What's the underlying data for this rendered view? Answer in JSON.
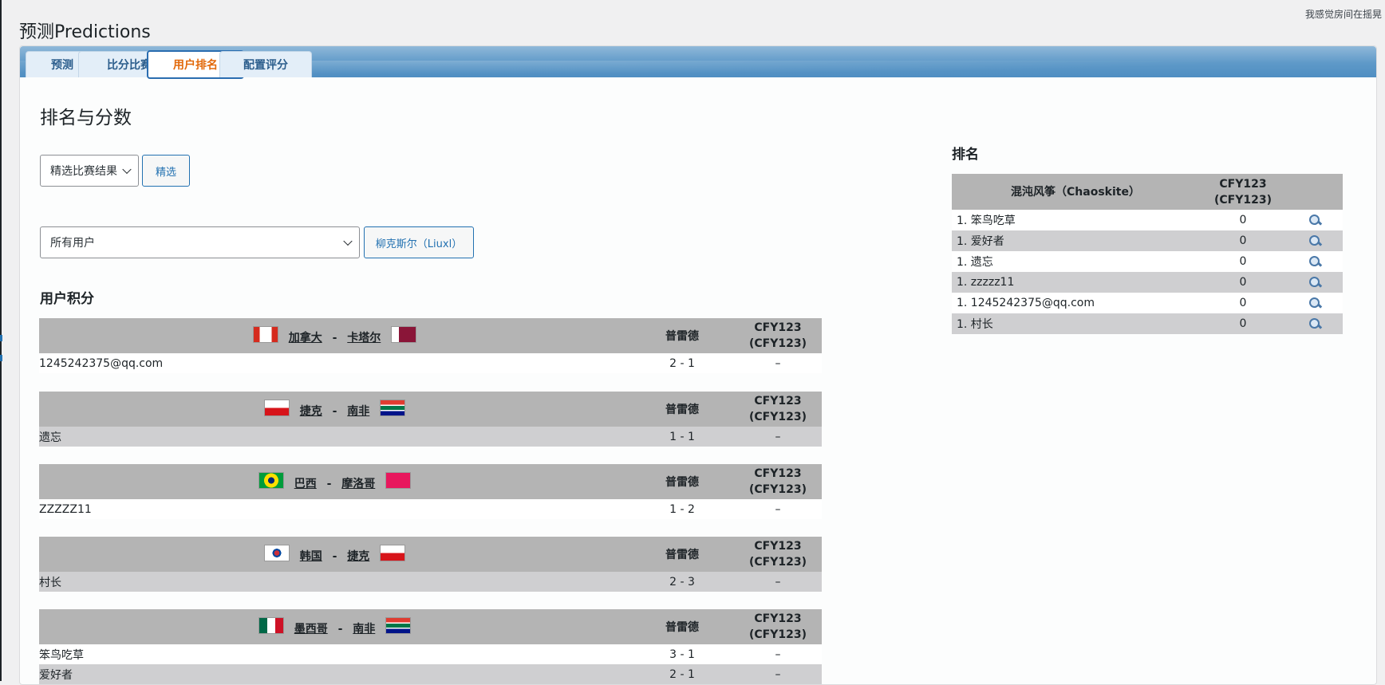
{
  "top_right_note": "我感觉房间在摇晃",
  "app_title": "预测Predictions",
  "tabs": [
    {
      "label": "预测"
    },
    {
      "label": "比分比赛"
    },
    {
      "label": "用户排名"
    },
    {
      "label": "配置评分"
    }
  ],
  "main": {
    "section_title": "排名与分数",
    "match_filter_select": "精选比赛结果",
    "filter_button": "精选",
    "user_select": "所有用户",
    "user_button": "柳克斯尔（Liuxl）",
    "user_scores_heading": "用户积分"
  },
  "score_tables": [
    {
      "home": "加拿大",
      "away": "卡塔尔",
      "dash": "-",
      "home_flag": "ca-flag",
      "away_flag": "qa-flag",
      "col_score": "普雷德",
      "col_cfy": "CFY123",
      "col_cfy2": "(CFY123)",
      "rows": [
        {
          "name": "1245242375@qq.com",
          "score": "2 - 1",
          "cfy": "–"
        }
      ]
    },
    {
      "home": "捷克",
      "away": "南非",
      "dash": "-",
      "home_flag": "cz-flag",
      "away_flag": "za-flag",
      "col_score": "普雷德",
      "col_cfy": "CFY123",
      "col_cfy2": "(CFY123)",
      "rows": [
        {
          "name": "遗忘",
          "score": "1 - 1",
          "cfy": "–"
        }
      ]
    },
    {
      "home": "巴西",
      "away": "摩洛哥",
      "dash": "-",
      "home_flag": "br-flag",
      "away_flag": "ma-flag",
      "col_score": "普雷德",
      "col_cfy": "CFY123",
      "col_cfy2": "(CFY123)",
      "rows": [
        {
          "name": "ZZZZZ11",
          "score": "1 - 2",
          "cfy": "–"
        }
      ]
    },
    {
      "home": "韩国",
      "away": "捷克",
      "dash": "-",
      "home_flag": "kr-flag",
      "away_flag": "cz-flag",
      "col_score": "普雷德",
      "col_cfy": "CFY123",
      "col_cfy2": "(CFY123)",
      "rows": [
        {
          "name": "村长",
          "score": "2 - 3",
          "cfy": "–"
        }
      ]
    },
    {
      "home": "墨西哥",
      "away": "南非",
      "dash": "-",
      "home_flag": "mx-flag",
      "away_flag": "za-flag",
      "col_score": "普雷德",
      "col_cfy": "CFY123",
      "col_cfy2": "(CFY123)",
      "rows": [
        {
          "name": "笨鸟吃草",
          "score": "3 - 1",
          "cfy": "–"
        },
        {
          "name": "爱好者",
          "score": "2 - 1",
          "cfy": "–"
        }
      ]
    }
  ],
  "ranking": {
    "heading": "排名",
    "col_name": "混沌风筝（Chaoskite）",
    "col_cfy": "CFY123",
    "col_cfy2": "(CFY123)",
    "rows": [
      {
        "name": "1. 笨鸟吃草",
        "score": "0",
        "icon": "magnifier-icon"
      },
      {
        "name": "1. 爱好者",
        "score": "0",
        "icon": "magnifier-icon"
      },
      {
        "name": "1. 遗忘",
        "score": "0",
        "icon": "magnifier-icon"
      },
      {
        "name": "1. zzzzz11",
        "score": "0",
        "icon": "magnifier-icon"
      },
      {
        "name": "1. 1245242375@qq.com",
        "score": "0",
        "icon": "magnifier-icon"
      },
      {
        "name": "1. 村长",
        "score": "0",
        "icon": "magnifier-icon"
      }
    ]
  }
}
